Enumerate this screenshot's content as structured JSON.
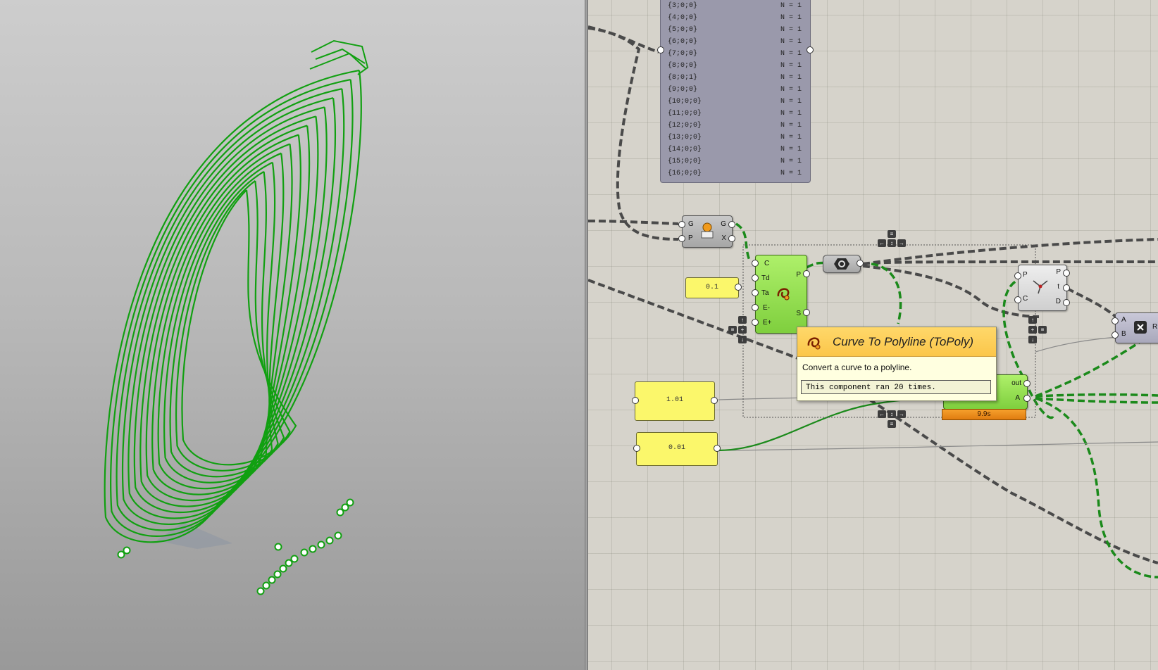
{
  "panel": {
    "rows": [
      {
        "path": "{3;0;0}",
        "count": "N = 1"
      },
      {
        "path": "{4;0;0}",
        "count": "N = 1"
      },
      {
        "path": "{5;0;0}",
        "count": "N = 1"
      },
      {
        "path": "{6;0;0}",
        "count": "N = 1"
      },
      {
        "path": "{7;0;0}",
        "count": "N = 1"
      },
      {
        "path": "{8;0;0}",
        "count": "N = 1"
      },
      {
        "path": "{8;0;1}",
        "count": "N = 1"
      },
      {
        "path": "{9;0;0}",
        "count": "N = 1"
      },
      {
        "path": "{10;0;0}",
        "count": "N = 1"
      },
      {
        "path": "{11;0;0}",
        "count": "N = 1"
      },
      {
        "path": "{12;0;0}",
        "count": "N = 1"
      },
      {
        "path": "{13;0;0}",
        "count": "N = 1"
      },
      {
        "path": "{14;0;0}",
        "count": "N = 1"
      },
      {
        "path": "{15;0;0}",
        "count": "N = 1"
      },
      {
        "path": "{16;0;0}",
        "count": "N = 1"
      }
    ]
  },
  "gate": {
    "in_g": "G",
    "in_p": "P",
    "out_g": "G",
    "out_x": "X"
  },
  "topoly": {
    "in_c": "C",
    "in_td": "Td",
    "in_ta": "Ta",
    "in_em": "E-",
    "in_ep": "E+",
    "out_p": "P",
    "out_s": "S"
  },
  "sliders": {
    "a": "0.1",
    "b": "1.01",
    "c": "0.01"
  },
  "curvecp": {
    "in_p": "P",
    "in_c": "C",
    "out_p": "P",
    "out_t": "t",
    "out_d": "D"
  },
  "multiply": {
    "in_a": "A",
    "in_b": "B",
    "out_r": "R"
  },
  "script": {
    "out_out": "out",
    "out_a": "A",
    "timer": "9.9s"
  },
  "tooltip": {
    "title": "Curve To Polyline (ToPoly)",
    "description": "Convert a curve to a polyline.",
    "runs": "This component ran 20 times."
  },
  "colors": {
    "curve_green": "#11a011",
    "wire_dark": "#4a4a4a",
    "component_green": "#8fdc4e",
    "slider_yellow": "#fbf76b",
    "panel_grey": "#9a99ab",
    "timer_orange": "#f08c1c"
  }
}
